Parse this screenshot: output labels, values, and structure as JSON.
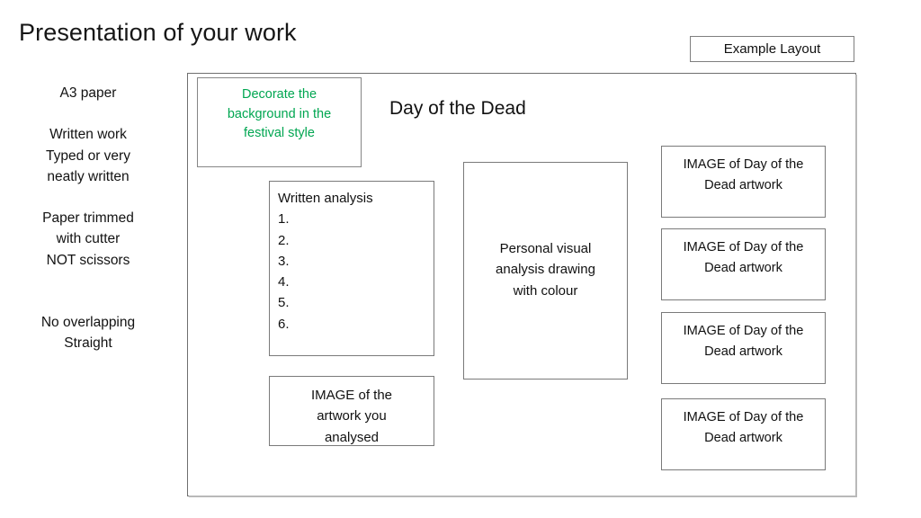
{
  "slide": {
    "title": "Presentation of your work",
    "caption_box": {
      "label": "Example Layout"
    }
  },
  "requirements": {
    "lines": [
      "A3 paper",
      "",
      "Written work",
      "Typed or very",
      "neatly written",
      "",
      "Paper trimmed",
      "with cutter",
      "NOT scissors",
      "",
      "",
      "No overlapping",
      "Straight"
    ]
  },
  "layout_sheet": {
    "heading": "Day of the Dead",
    "decorate_box": {
      "text": "Decorate the\nbackground in the\nfestival style",
      "color": "#00a651"
    },
    "written_analysis_box": {
      "text": "Written analysis\n1.\n2.\n3.\n4.\n5.\n6."
    },
    "artwork_analysed_box": {
      "text": "IMAGE of the\nartwork you\nanalysed"
    },
    "personal_visual_box": {
      "text": "Personal visual\nanalysis drawing\nwith colour"
    },
    "image_boxes": [
      {
        "text": "IMAGE of Day of the\nDead artwork"
      },
      {
        "text": "IMAGE of Day of the\nDead artwork"
      },
      {
        "text": "IMAGE of Day of the\nDead artwork"
      },
      {
        "text": "IMAGE of Day of the\nDead artwork"
      }
    ]
  },
  "colors": {
    "accent_green": "#00a651",
    "border_gray": "#7a7a7a",
    "text_black": "#111111"
  }
}
